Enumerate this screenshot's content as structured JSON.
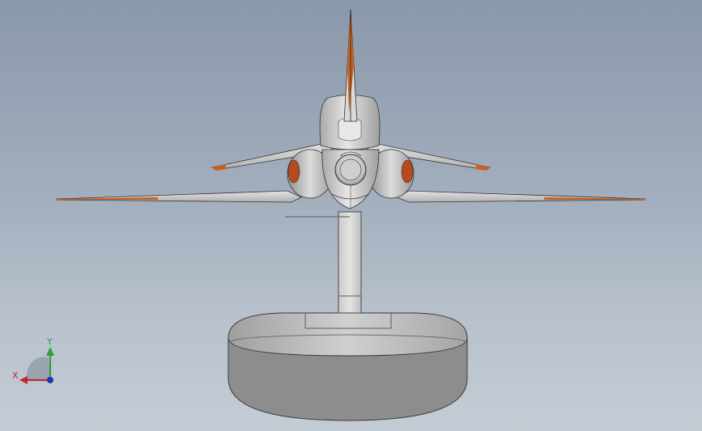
{
  "viewport": {
    "background_top": "#8a98ab",
    "background_bottom": "#c4ccd5"
  },
  "model": {
    "object": "aircraft-rear-view-on-display-stand",
    "body_color": "#d9d9d9",
    "accent_color": "#d2691e",
    "stand_color": "#8c8c8c"
  },
  "triad": {
    "x_label": "X",
    "y_label": "Y",
    "x_color": "#c0262b",
    "y_color": "#2e9e3e",
    "z_color": "#2431b8"
  }
}
